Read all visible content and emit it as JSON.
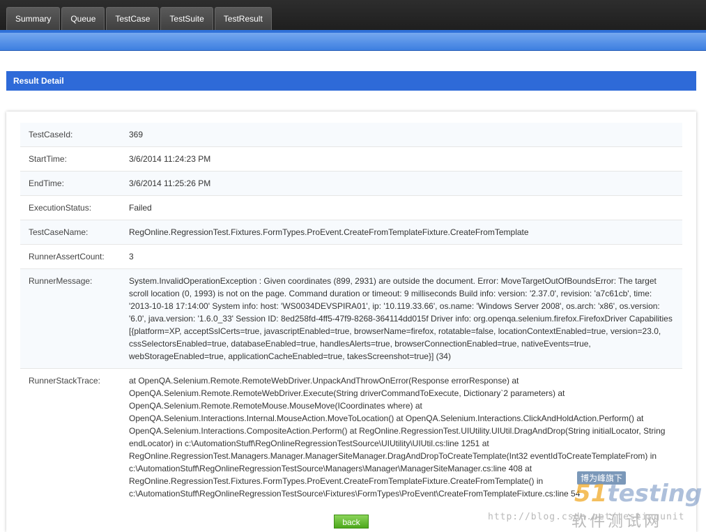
{
  "nav": {
    "tabs": [
      {
        "label": "Summary"
      },
      {
        "label": "Queue"
      },
      {
        "label": "TestCase"
      },
      {
        "label": "TestSuite"
      },
      {
        "label": "TestResult"
      }
    ]
  },
  "section": {
    "title": "Result Detail"
  },
  "details": {
    "rows": [
      {
        "label": "TestCaseId:",
        "value": "369"
      },
      {
        "label": "StartTime:",
        "value": "3/6/2014 11:24:23 PM"
      },
      {
        "label": "EndTime:",
        "value": "3/6/2014 11:25:26 PM"
      },
      {
        "label": "ExecutionStatus:",
        "value": "Failed"
      },
      {
        "label": "TestCaseName:",
        "value": "RegOnline.RegressionTest.Fixtures.FormTypes.ProEvent.CreateFromTemplateFixture.CreateFromTemplate"
      },
      {
        "label": "RunnerAssertCount:",
        "value": "3"
      },
      {
        "label": "RunnerMessage:",
        "value": "System.InvalidOperationException : Given coordinates (899, 2931) are outside the document. Error: MoveTargetOutOfBoundsError: The target scroll location (0, 1993) is not on the page. Command duration or timeout: 9 milliseconds Build info: version: '2.37.0', revision: 'a7c61cb', time: '2013-10-18 17:14:00' System info: host: 'WS0034DEVSPIRA01', ip: '10.119.33.66', os.name: 'Windows Server 2008', os.arch: 'x86', os.version: '6.0', java.version: '1.6.0_33' Session ID: 8ed258fd-4ff5-47f9-8268-364114dd015f Driver info: org.openqa.selenium.firefox.FirefoxDriver Capabilities [{platform=XP, acceptSslCerts=true, javascriptEnabled=true, browserName=firefox, rotatable=false, locationContextEnabled=true, version=23.0, cssSelectorsEnabled=true, databaseEnabled=true, handlesAlerts=true, browserConnectionEnabled=true, nativeEvents=true, webStorageEnabled=true, applicationCacheEnabled=true, takesScreenshot=true}] (34)"
      },
      {
        "label": "RunnerStackTrace:",
        "value": "at OpenQA.Selenium.Remote.RemoteWebDriver.UnpackAndThrowOnError(Response errorResponse) at OpenQA.Selenium.Remote.RemoteWebDriver.Execute(String driverCommandToExecute, Dictionary`2 parameters) at OpenQA.Selenium.Remote.RemoteMouse.MouseMove(ICoordinates where) at OpenQA.Selenium.Interactions.Internal.MouseAction.MoveToLocation() at OpenQA.Selenium.Interactions.ClickAndHoldAction.Perform() at OpenQA.Selenium.Interactions.CompositeAction.Perform() at RegOnline.RegressionTest.UIUtility.UIUtil.DragAndDrop(String initialLocator, String endLocator) in c:\\AutomationStuff\\RegOnlineRegressionTestSource\\UIUtility\\UIUtil.cs:line 1251 at RegOnline.RegressionTest.Managers.Manager.ManagerSiteManager.DragAndDropToCreateTemplate(Int32 eventIdToCreateTemplateFrom) in c:\\AutomationStuff\\RegOnlineRegressionTestSource\\Managers\\Manager\\ManagerSiteManager.cs:line 408 at RegOnline.RegressionTest.Fixtures.FormTypes.ProEvent.CreateFromTemplateFixture.CreateFromTemplate() in c:\\AutomationStuff\\RegOnlineRegressionTestSource\\Fixtures\\FormTypes\\ProEvent\\CreateFromTemplateFixture.cs:line 54"
      }
    ]
  },
  "actions": {
    "back_label": "back"
  },
  "watermark": {
    "tag": "博为峰旗下",
    "brand_num": "51",
    "brand_text": "testing",
    "brand_cn": "软件测试网",
    "url": "http://blog.csdn.net/testingunit"
  },
  "colors": {
    "topbar": "#262626",
    "accent_blue": "#2e6ad8",
    "back_button": "#5cb82a"
  }
}
